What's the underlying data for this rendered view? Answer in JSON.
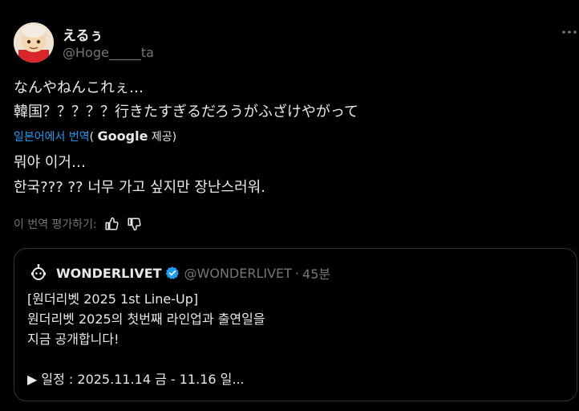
{
  "author": {
    "name": "えるぅ",
    "handle": "@Hoge_____ta",
    "avatar_icon": "avatar-image"
  },
  "more_icon": "more-horizontal-icon",
  "tweet": {
    "original_lines": [
      "なんやねんこれぇ…",
      "韓国？？？？？行きたすぎるだろうがふざけやがって"
    ],
    "translate_link": "일본어에서 번역",
    "translate_provider_prefix": "( ",
    "translate_provider_name": "Google",
    "translate_provider_suffix": " 제공)",
    "translated_lines": [
      "뭐야 이거…",
      "한국??? ?? 너무 가고 싶지만 장난스러워."
    ]
  },
  "rating": {
    "label": "이 번역 평가하기:",
    "thumbs_up_icon": "thumbs-up-icon",
    "thumbs_down_icon": "thumbs-down-icon"
  },
  "quote": {
    "name": "WONDERLIVET",
    "handle": "@WONDERLIVET",
    "separator": "·",
    "time": "45분",
    "lines": [
      "[원더리벳 2025 1st Line-Up]",
      "원더리벳 2025의 첫번째 라인업과 출연일을",
      "지금 공개합니다!",
      "",
      "▶ 일정 : 2025.11.14 금 - 11.16 일..."
    ]
  },
  "colors": {
    "background": "#000000",
    "text": "#e7e9ea",
    "secondary": "#71767b",
    "link": "#1d9bf0",
    "border": "#2f3336",
    "verified": "#1d9bf0"
  }
}
